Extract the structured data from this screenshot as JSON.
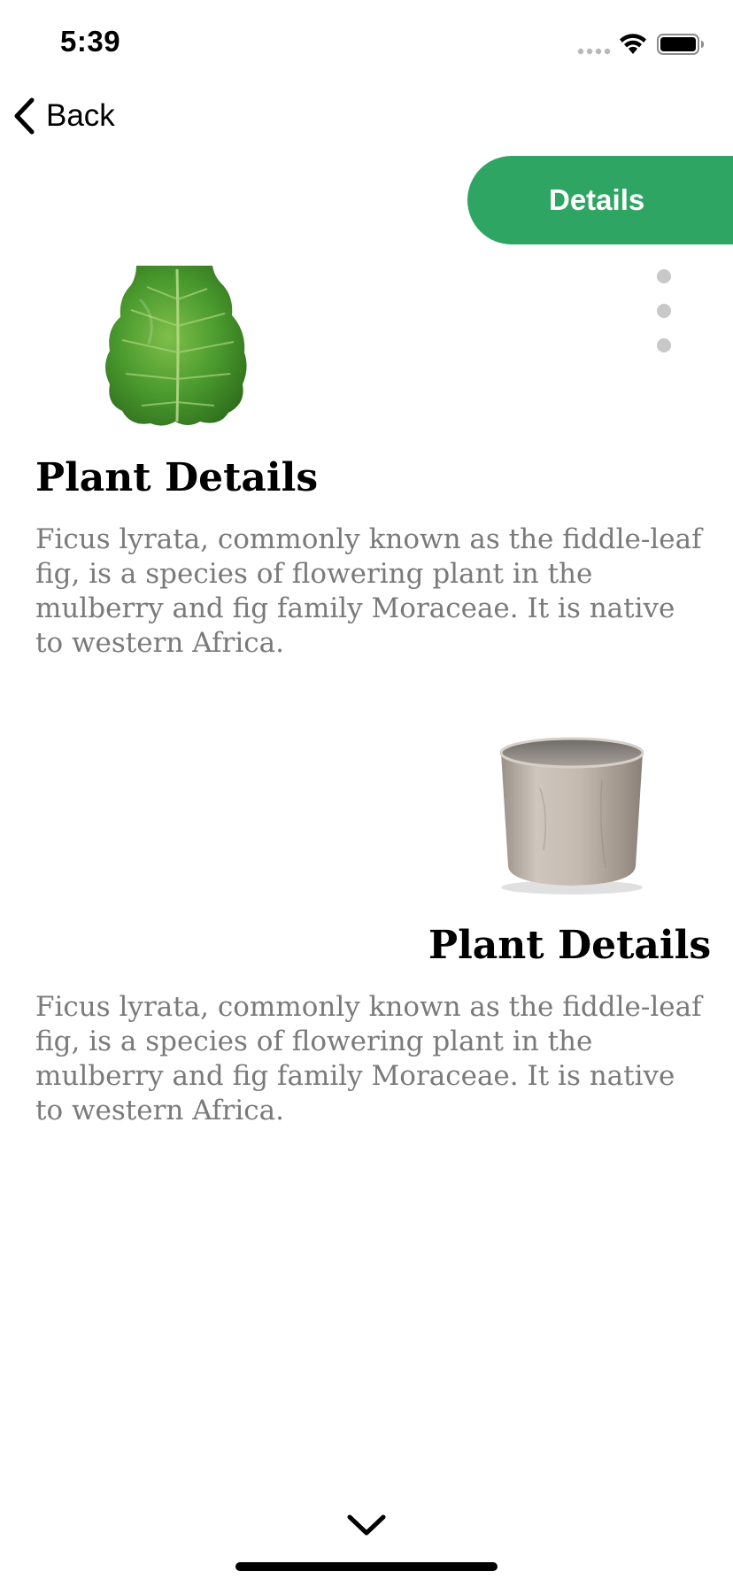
{
  "status_bar": {
    "time": "5:39"
  },
  "nav": {
    "back_label": "Back"
  },
  "details_button": {
    "label": "Details"
  },
  "pager": {
    "dot_count": 3
  },
  "sections": [
    {
      "title": "Plant Details",
      "description": "Ficus lyrata, commonly known as the fiddle-leaf fig, is a species of flowering plant in the mulberry and fig family Moraceae. It is native to western Africa.",
      "image": "fiddle-leaf-image"
    },
    {
      "title": "Plant Details",
      "description": "Ficus lyrata, commonly known as the fiddle-leaf fig, is a species of flowering plant in the mulberry and fig family Moraceae. It is native to western Africa.",
      "image": "plant-pot-image"
    }
  ],
  "colors": {
    "accent": "#2ea563",
    "description_text": "#7a7a7a",
    "pager_dot": "#c8c8c8"
  },
  "icons": {
    "back": "chevron-left-icon",
    "bottom": "chevron-down-icon",
    "wifi": "wifi-icon",
    "battery": "battery-icon",
    "signal": "signal-icon"
  }
}
